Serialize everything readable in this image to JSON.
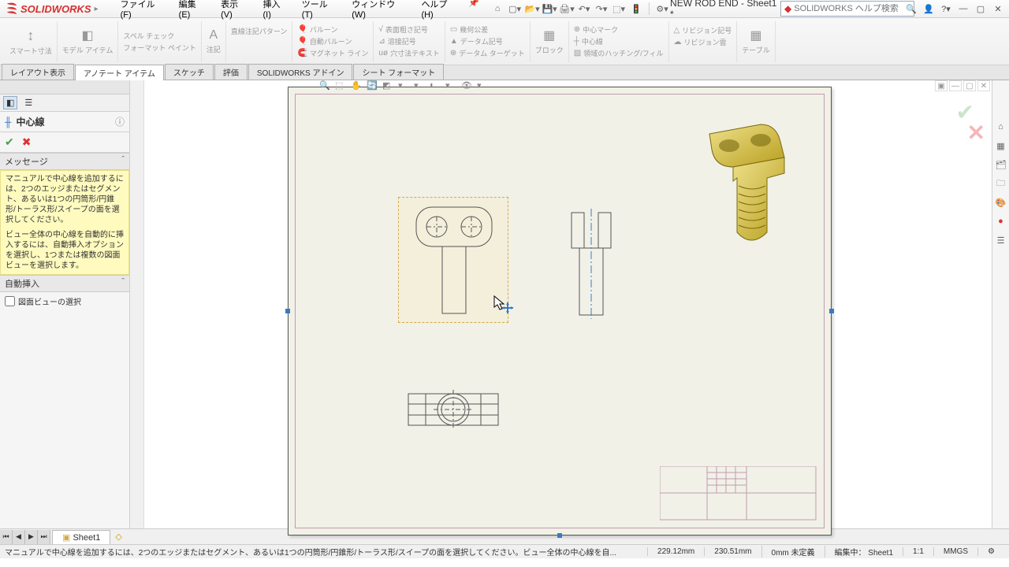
{
  "app": {
    "name": "SOLIDWORKS",
    "doc_title": "NEW ROD END - Sheet1 *"
  },
  "menus": {
    "file": "ファイル(F)",
    "edit": "編集(E)",
    "view": "表示(V)",
    "insert": "挿入(I)",
    "tools": "ツール(T)",
    "window": "ウィンドウ(W)",
    "help": "ヘルプ(H)"
  },
  "search": {
    "placeholder": "SOLIDWORKS ヘルプ検索"
  },
  "ribbon": {
    "smart_dim": "スマート寸法",
    "model_item": "モデル アイテム",
    "spell": "スペル チェック",
    "fmt_paint": "フォーマット ペイント",
    "note": "注記",
    "lin_note": "直線注記パターン",
    "balloon": "バルーン",
    "auto_balloon": "自動バルーン",
    "magnet": "マグネット ライン",
    "surf_finish": "表面粗さ記号",
    "weld": "溶接記号",
    "hole": "穴寸法テキスト",
    "geo_tol": "幾何公差",
    "datum": "データム記号",
    "datum_tgt": "データム ターゲット",
    "block": "ブロック",
    "ctr_mark": "中心マーク",
    "ctr_line": "中心線",
    "hatch": "領域のハッチング/フィル",
    "rev_sym": "リビジョン記号",
    "rev_cloud": "リビジョン雲",
    "table": "テーブル"
  },
  "tabs": {
    "layout": "レイアウト表示",
    "annot": "アノテート アイテム",
    "sketch": "スケッチ",
    "eval": "評価",
    "addins": "SOLIDWORKS アドイン",
    "sheetfmt": "シート フォーマット"
  },
  "pm": {
    "title": "中心線",
    "msg_hdr": "メッセージ",
    "msg_body1": "マニュアルで中心線を追加するには、2つのエッジまたはセグメント、あるいは1つの円筒形/円錐形/トーラス形/スイープの面を選択してください。",
    "msg_body2": "ビュー全体の中心線を自動的に挿入するには、自動挿入オプションを選択し、1つまたは複数の図面ビューを選択します。",
    "auto_hdr": "自動挿入",
    "auto_chk": "図面ビューの選択"
  },
  "sheet_tab": "Sheet1",
  "status": {
    "hint": "マニュアルで中心線を追加するには、2つのエッジまたはセグメント、あるいは1つの円筒形/円錐形/トーラス形/スイープの面を選択してください。ビュー全体の中心線を自...",
    "x": "229.12mm",
    "y": "230.51mm",
    "z": "0mm",
    "def": "未定義",
    "editing": "編集中：  Sheet1",
    "scale": "1:1",
    "units": "MMGS"
  }
}
